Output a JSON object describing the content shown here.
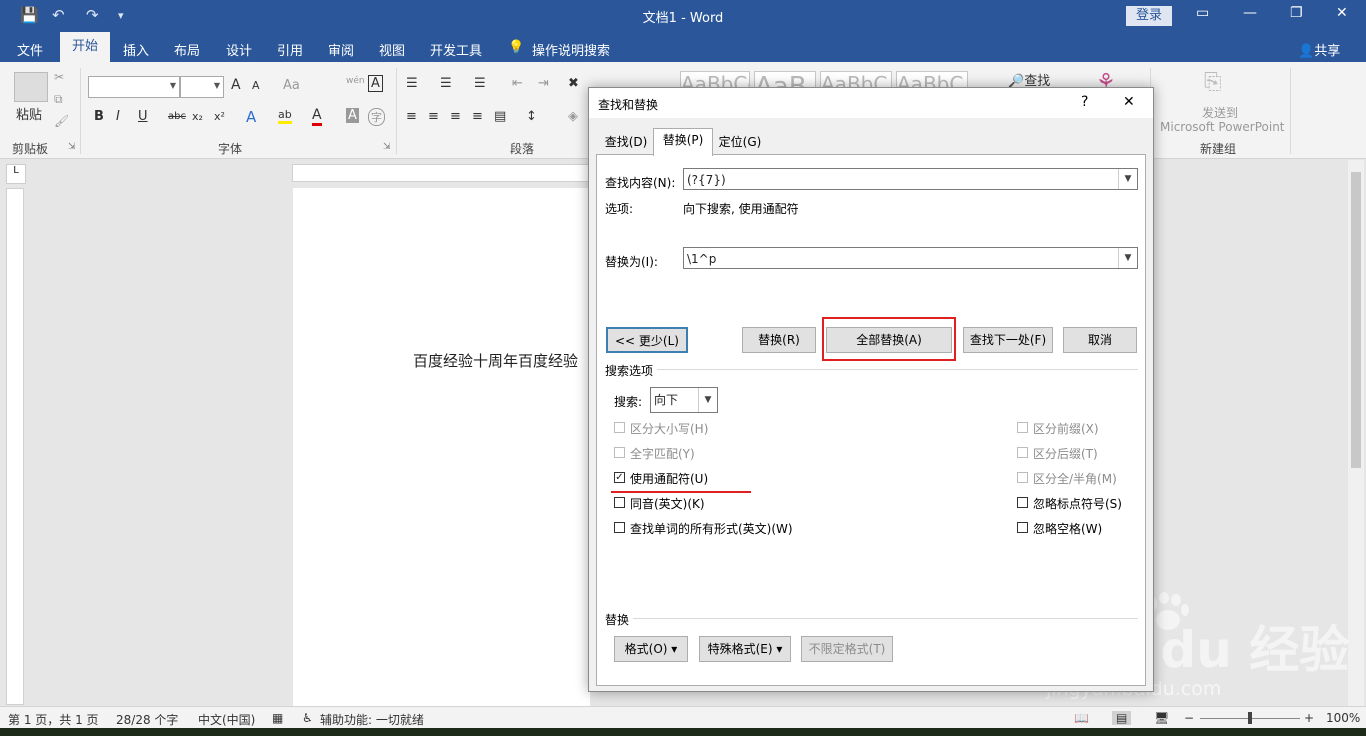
{
  "window": {
    "title": "文档1  -  Word",
    "login_label": "登录",
    "share_label": "共享",
    "controls": {
      "ribbon_display": "▭",
      "minimize": "—",
      "restore": "❐",
      "close": "✕"
    }
  },
  "quick_access": {
    "save": "💾",
    "undo": "↶",
    "redo": "↷",
    "customize": "▾"
  },
  "menu": {
    "file": "文件",
    "home": "开始",
    "insert": "插入",
    "layout": "布局",
    "design": "设计",
    "references": "引用",
    "review": "审阅",
    "view": "视图",
    "developer": "开发工具",
    "tell_me": "操作说明搜索"
  },
  "ribbon": {
    "groups": {
      "clipboard": "剪贴板",
      "font": "字体",
      "paragraph": "段落",
      "new_group": "新建组"
    },
    "paste_label": "粘贴",
    "find_label": "查找",
    "send_label_1": "发送到",
    "send_label_2": "Microsoft PowerPoint",
    "font_buttons": {
      "bold": "B",
      "italic": "I",
      "underline": "U",
      "strike": "abc",
      "sub": "x₂",
      "sup": "x²",
      "grow": "A",
      "shrink": "A",
      "case": "Aa",
      "phonetic": "wén",
      "border": "A",
      "highlight": "ab",
      "color": "A",
      "shade": "A",
      "enclose": "字"
    },
    "style_preview": [
      "AaBbCcDd",
      "AaB",
      "AaBbC",
      "AaBbC"
    ]
  },
  "document": {
    "text": "百度经验十周年百度经验"
  },
  "status": {
    "page": "第 1 页，共 1 页",
    "words": "28/28 个字",
    "lang": "中文(中国)",
    "accessibility": "辅助功能: 一切就绪",
    "zoom": "100%",
    "zoom_level": 1.0
  },
  "dialog": {
    "title": "查找和替换",
    "help": "?",
    "close": "✕",
    "tabs": {
      "find": "查找(D)",
      "replace": "替换(P)",
      "goto": "定位(G)"
    },
    "find_label": "查找内容(N):",
    "find_value": "(?{7})",
    "options_label": "选项:",
    "options_value": "向下搜索, 使用通配符",
    "replace_label": "替换为(I):",
    "replace_value": "\\1^p",
    "buttons": {
      "less": "<< 更少(L)",
      "replace": "替换(R)",
      "replace_all": "全部替换(A)",
      "find_next": "查找下一处(F)",
      "cancel": "取消"
    },
    "search_options_title": "搜索选项",
    "search_label": "搜索:",
    "search_value": "向下",
    "checkboxes_left": [
      {
        "label": "区分大小写(H)",
        "checked": false,
        "enabled": false
      },
      {
        "label": "全字匹配(Y)",
        "checked": false,
        "enabled": false
      },
      {
        "label": "使用通配符(U)",
        "checked": true,
        "enabled": true
      },
      {
        "label": "同音(英文)(K)",
        "checked": false,
        "enabled": true
      },
      {
        "label": "查找单词的所有形式(英文)(W)",
        "checked": false,
        "enabled": true
      }
    ],
    "checkboxes_right": [
      {
        "label": "区分前缀(X)",
        "checked": false,
        "enabled": false
      },
      {
        "label": "区分后缀(T)",
        "checked": false,
        "enabled": false
      },
      {
        "label": "区分全/半角(M)",
        "checked": false,
        "enabled": false
      },
      {
        "label": "忽略标点符号(S)",
        "checked": false,
        "enabled": true
      },
      {
        "label": "忽略空格(W)",
        "checked": false,
        "enabled": true
      }
    ],
    "replace_section_title": "替换",
    "format_button": "格式(O) ▾",
    "special_button": "特殊格式(E) ▾",
    "no_format_button": "不限定格式(T)",
    "highlight_color": "#e02020"
  },
  "watermark": {
    "brand": "Bai du 经验",
    "url": "jingyan.baidu.com"
  }
}
